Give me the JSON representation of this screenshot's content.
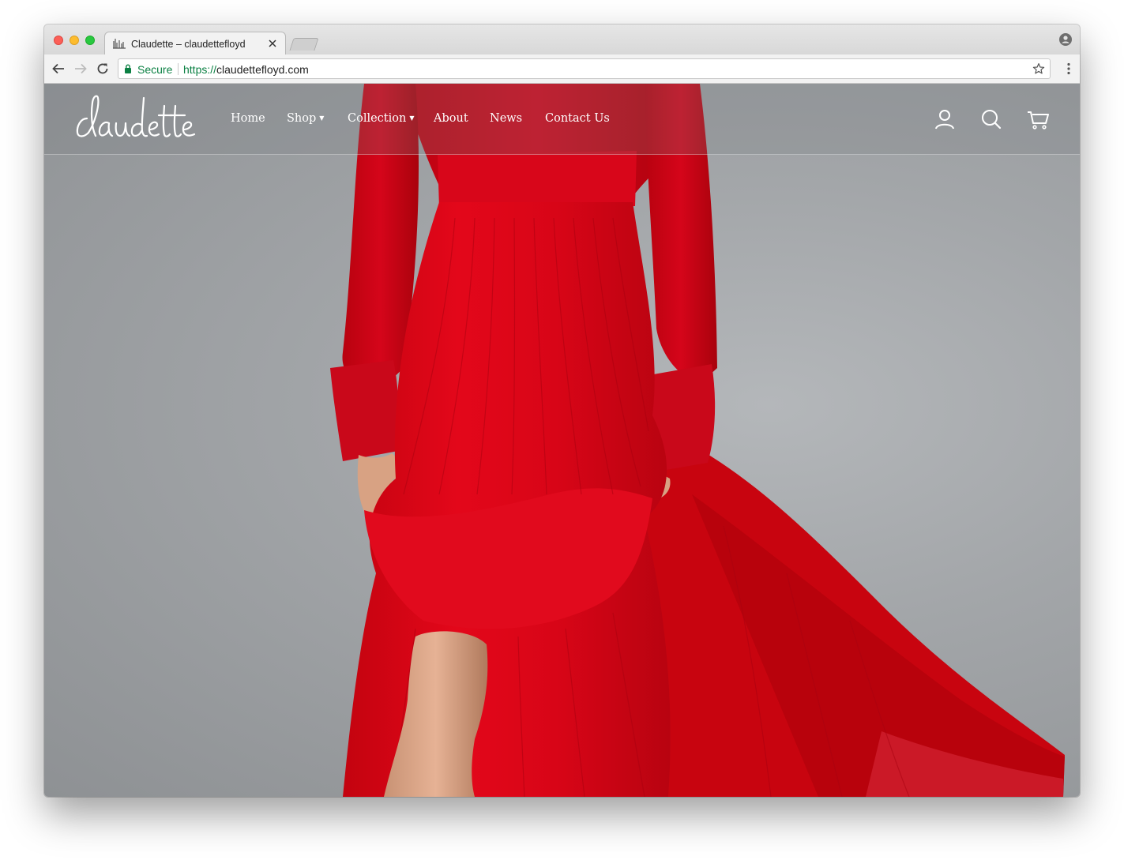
{
  "browser": {
    "tab": {
      "title": "Claudette – claudettefloyd"
    },
    "omnibox": {
      "secure_label": "Secure",
      "url_scheme": "https://",
      "url_host": "claudettefloyd.com"
    }
  },
  "site": {
    "logo_text": "claudette",
    "nav": [
      {
        "label": "Home",
        "has_dropdown": false
      },
      {
        "label": "Shop",
        "has_dropdown": true
      },
      {
        "label": "Collection",
        "has_dropdown": true
      },
      {
        "label": "About",
        "has_dropdown": false
      },
      {
        "label": "News",
        "has_dropdown": false
      },
      {
        "label": "Contact Us",
        "has_dropdown": false
      }
    ],
    "dropdown_caret": "▼",
    "header_icons": [
      "account-icon",
      "search-icon",
      "cart-icon"
    ]
  },
  "colors": {
    "secure_green": "#0b8043",
    "dress_red": "#e0051a",
    "backdrop_grey": "#a3a6a9"
  }
}
